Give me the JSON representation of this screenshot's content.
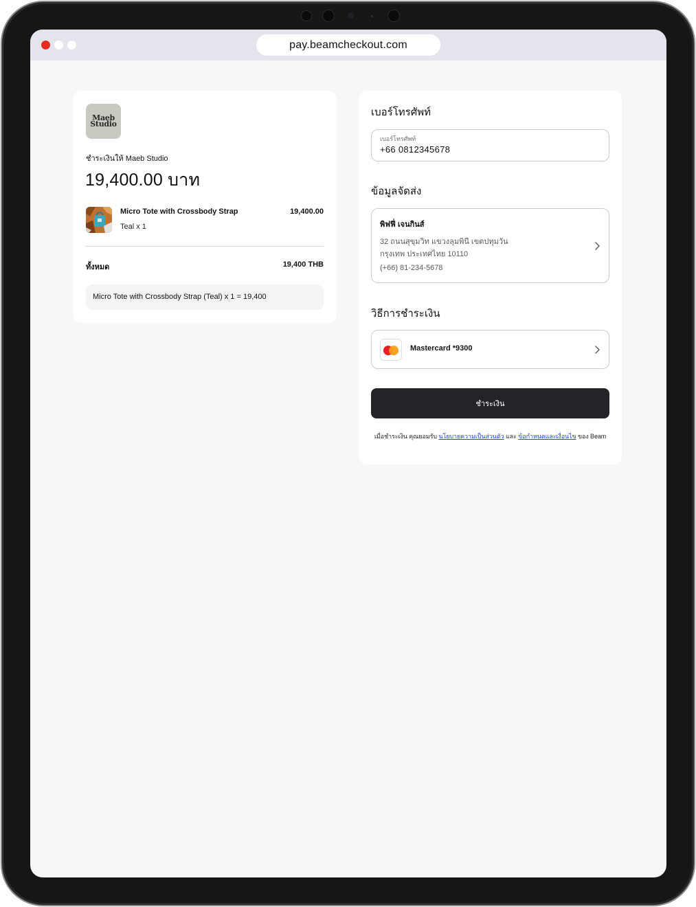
{
  "browser": {
    "url": "pay.beamcheckout.com"
  },
  "merchant": {
    "logo_text": "Maeb Studio",
    "logo_line1": "Maeb",
    "logo_line2": "Studio",
    "pay_to_label": "ชำระเงินให้ Maeb Studio",
    "amount": "19,400.00 บาท"
  },
  "order": {
    "items": [
      {
        "name": "Micro Tote with Crossbody Strap",
        "variant": "Teal x 1",
        "price": "19,400.00"
      }
    ],
    "total_label": "ทั้งหมด",
    "total_value": "19,400 THB",
    "summary": "Micro Tote with Crossbody Strap (Teal) x 1 = 19,400"
  },
  "phone": {
    "section_title": "เบอร์โทรศัพท์",
    "field_label": "เบอร์โทรศัพท์",
    "value": "+66  0812345678"
  },
  "shipping": {
    "section_title": "ข้อมูลจัดส่ง",
    "name": "พิฟฟี่ เจนกินส์",
    "address_line1": "32 ถนนสุขุมวิท แขวงลุมพินี เขตปทุมวัน",
    "address_line2": "กรุงเทพ ประเทศไทย 10110",
    "phone": "(+66) 81-234-5678"
  },
  "payment": {
    "section_title": "วิธีการชำระเงิน",
    "method_label": "Mastercard *9300",
    "pay_button": "ชำระเงิน"
  },
  "terms": {
    "prefix": "เมื่อชำระเงิน คุณยอมรับ",
    "privacy_link": "นโยบายความเป็นส่วนตัว",
    "and": "และ",
    "terms_link": "ข้อกำหนดและเงื่อนไข",
    "suffix": "ของ Beam"
  },
  "colors": {
    "accent_button": "#222427",
    "link": "#1a4bd6",
    "mastercard_red": "#eb1c25",
    "mastercard_yellow": "#f99f1b",
    "window_close": "#e52b1e"
  },
  "icons": [
    "chevron-right-icon",
    "mastercard-icon",
    "camera-icon"
  ]
}
